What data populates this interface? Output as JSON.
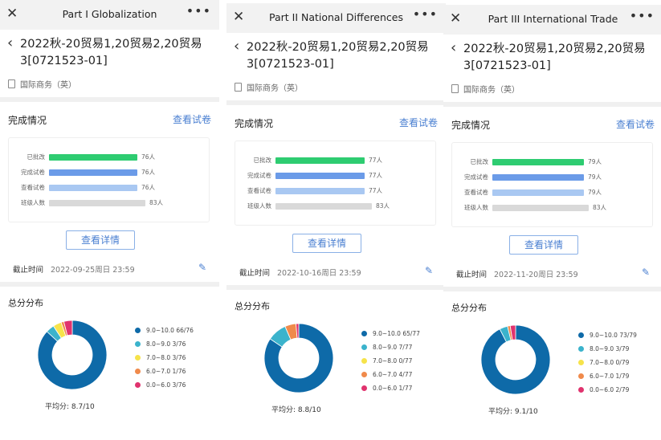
{
  "colors": {
    "graded": "#2ecc71",
    "completed": "#6b9be8",
    "viewed": "#a9c8f2",
    "class": "#d9d9d9",
    "accent": "#4a7fd1",
    "slices": [
      "#0e6aa8",
      "#3bb3cc",
      "#f6e34a",
      "#f08a4b",
      "#e0336e"
    ]
  },
  "labels": {
    "completion_title": "完成情况",
    "view_paper": "查看试卷",
    "view_detail": "查看详情",
    "deadline_label": "截止时间",
    "distribution_title": "总分分布",
    "avg_prefix": "平均分:",
    "bar_labels": [
      "已批改",
      "完成试卷",
      "查看试卷",
      "班级人数"
    ],
    "legend_ranges": [
      "9.0~10.0",
      "8.0~9.0",
      "7.0~8.0",
      "6.0~7.0",
      "0.0~6.0"
    ]
  },
  "panels": [
    {
      "title": "Part I Globalization",
      "course": "2022秋-20贸易1,20贸易2,20贸易3[0721523-01]",
      "subject": "国际商务（英）",
      "bars": [
        {
          "count": 76,
          "text": "76人"
        },
        {
          "count": 76,
          "text": "76人"
        },
        {
          "count": 76,
          "text": "76人"
        },
        {
          "count": 83,
          "text": "83人"
        }
      ],
      "deadline": "2022-09-25周日 23:59",
      "distribution": [
        {
          "count": 66,
          "text": "66/76"
        },
        {
          "count": 3,
          "text": "3/76"
        },
        {
          "count": 3,
          "text": "3/76"
        },
        {
          "count": 1,
          "text": "1/76"
        },
        {
          "count": 3,
          "text": "3/76"
        }
      ],
      "avg": "8.7/10"
    },
    {
      "title": "Part II National Differences",
      "course": "2022秋-20贸易1,20贸易2,20贸易3[0721523-01]",
      "subject": "国际商务（英）",
      "bars": [
        {
          "count": 77,
          "text": "77人"
        },
        {
          "count": 77,
          "text": "77人"
        },
        {
          "count": 77,
          "text": "77人"
        },
        {
          "count": 83,
          "text": "83人"
        }
      ],
      "deadline": "2022-10-16周日 23:59",
      "distribution": [
        {
          "count": 65,
          "text": "65/77"
        },
        {
          "count": 7,
          "text": "7/77"
        },
        {
          "count": 0,
          "text": "0/77"
        },
        {
          "count": 4,
          "text": "4/77"
        },
        {
          "count": 1,
          "text": "1/77"
        }
      ],
      "avg": "8.8/10"
    },
    {
      "title": "Part III International Trade",
      "course": "2022秋-20贸易1,20贸易2,20贸易3[0721523-01]",
      "subject": "国际商务（英）",
      "bars": [
        {
          "count": 79,
          "text": "79人"
        },
        {
          "count": 79,
          "text": "79人"
        },
        {
          "count": 79,
          "text": "79人"
        },
        {
          "count": 83,
          "text": "83人"
        }
      ],
      "deadline": "2022-11-20周日 23:59",
      "distribution": [
        {
          "count": 73,
          "text": "73/79"
        },
        {
          "count": 3,
          "text": "3/79"
        },
        {
          "count": 0,
          "text": "0/79"
        },
        {
          "count": 1,
          "text": "1/79"
        },
        {
          "count": 2,
          "text": "2/79"
        }
      ],
      "avg": "9.1/10"
    }
  ]
}
